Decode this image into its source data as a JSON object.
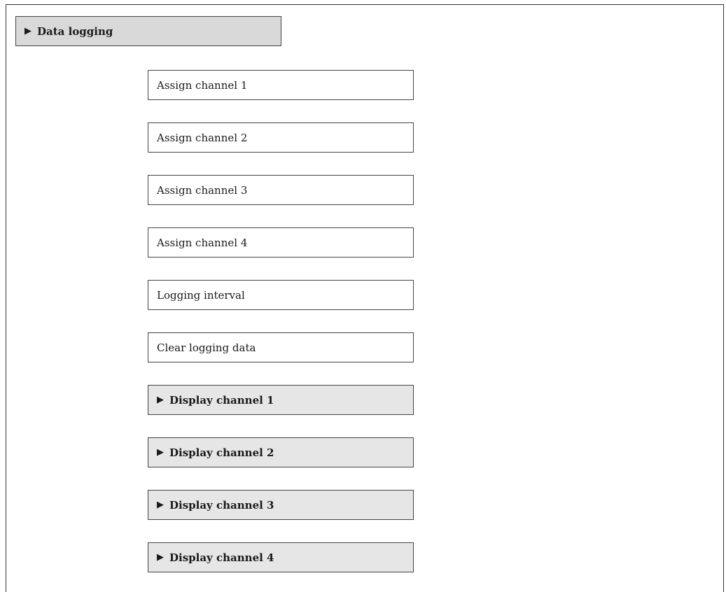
{
  "menu": {
    "root": {
      "label": "Data logging",
      "icon": "triangle-right-icon"
    },
    "parameters": [
      {
        "label": "Assign channel 1"
      },
      {
        "label": "Assign channel 2"
      },
      {
        "label": "Assign channel 3"
      },
      {
        "label": "Assign channel 4"
      },
      {
        "label": "Logging interval"
      },
      {
        "label": "Clear logging data"
      }
    ],
    "submenus": [
      {
        "label": "Display channel 1",
        "icon": "triangle-right-icon"
      },
      {
        "label": "Display channel 2",
        "icon": "triangle-right-icon"
      },
      {
        "label": "Display channel 3",
        "icon": "triangle-right-icon"
      },
      {
        "label": "Display channel 4",
        "icon": "triangle-right-icon"
      }
    ]
  }
}
